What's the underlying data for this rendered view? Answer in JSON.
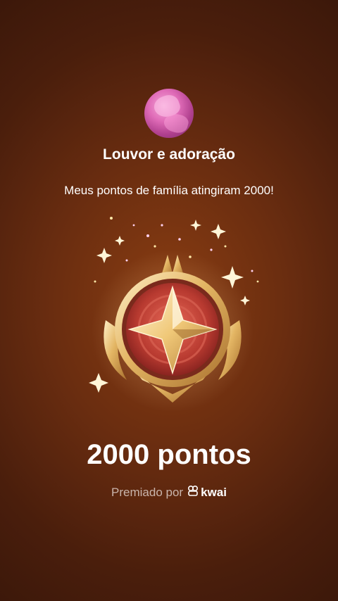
{
  "family": {
    "name": "Louvor e adoração"
  },
  "message": "Meus pontos de família atingiram 2000!",
  "badge": {
    "icon": "star-medal-icon"
  },
  "points_label": "2000 pontos",
  "awarded": {
    "prefix": "Premiado por",
    "brand": "kwai",
    "brand_icon": "kwai-logo-icon"
  },
  "colors": {
    "background": "#6a2d10",
    "gold": "#e8c070",
    "red_core": "#c84a3a"
  }
}
